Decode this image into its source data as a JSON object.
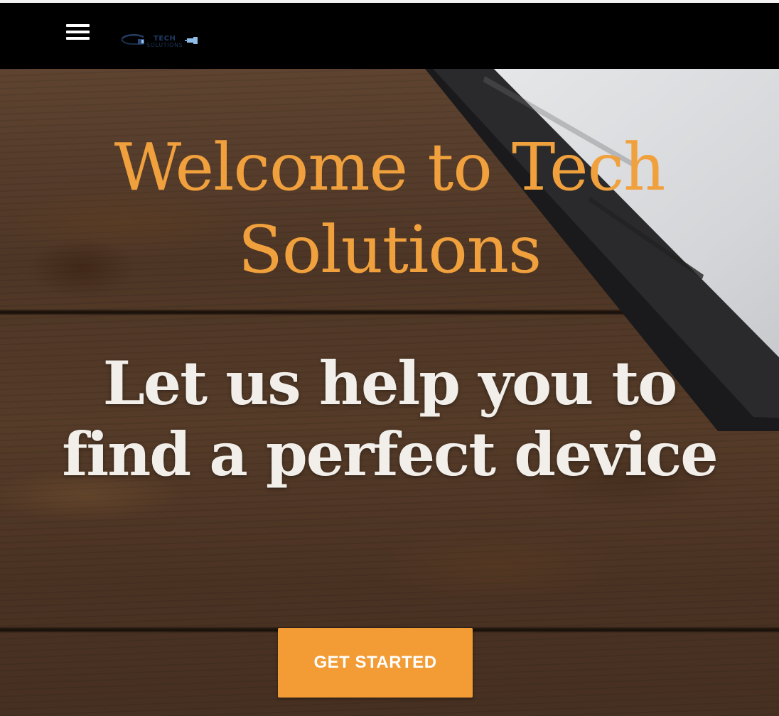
{
  "navbar": {
    "menu_icon": "hamburger-menu-icon",
    "logo": {
      "icon": "cable-plug-icon",
      "text_main": "TECH",
      "text_sub": "SOLUTIONS"
    }
  },
  "hero": {
    "title": "Welcome to Tech Solutions",
    "subtitle": "Let us help you to find a perfect device",
    "cta_label": "GET STARTED"
  },
  "colors": {
    "navbar_bg": "#000000",
    "title": "#f0a03c",
    "subtitle": "#f2efea",
    "cta_bg": "#f39b34",
    "cta_text": "#ffffff",
    "wood": "#4e3626"
  }
}
